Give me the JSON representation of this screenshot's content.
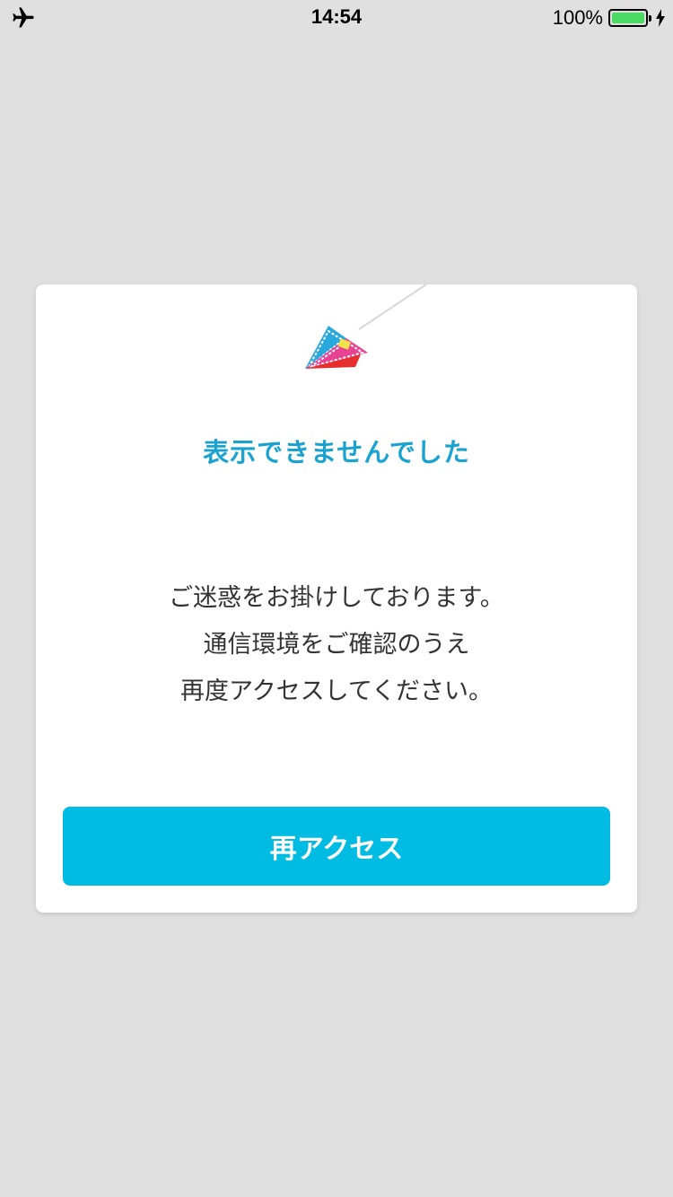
{
  "status_bar": {
    "time": "14:54",
    "battery_text": "100%",
    "battery_level": 1.0,
    "battery_color": "#4cd964",
    "left_icon": "airplane-mode-icon",
    "charging_icon": "charging-bolt-icon"
  },
  "error_card": {
    "illustration_icon": "paper-airplane-icon",
    "title": "表示できませんでした",
    "message_lines": [
      "ご迷惑をお掛けしております。",
      "通信環境をご確認のうえ",
      "再度アクセスしてください。"
    ],
    "retry_label": "再アクセス"
  },
  "colors": {
    "title": "#1aa3d1",
    "button": "#00bce3",
    "background": "#e0e0e0"
  }
}
